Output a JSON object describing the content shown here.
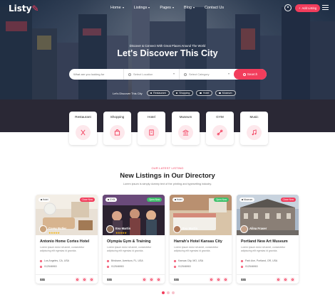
{
  "brand": {
    "name": "Listy",
    "accent": "#f23d5c"
  },
  "nav": {
    "items": [
      {
        "label": "Home",
        "has_caret": true
      },
      {
        "label": "Listings",
        "has_caret": true
      },
      {
        "label": "Pages",
        "has_caret": true
      },
      {
        "label": "Blog",
        "has_caret": true
      },
      {
        "label": "Contact Us",
        "has_caret": false
      }
    ],
    "add_listing_label": "Add Listing",
    "user_icon": "user-icon",
    "menu_icon": "hamburger-icon"
  },
  "hero": {
    "subtitle": "Discover & Connect With Great Places Around The World",
    "title": "Let's Discover This City",
    "search": {
      "keyword_placeholder": "What are you looking for",
      "location_placeholder": "Select Location",
      "category_placeholder": "Select Category",
      "button_label": "Search"
    },
    "quick_label": "Let's Discover This City",
    "quick_chips": [
      "Restaurant",
      "Shopping",
      "Hotel",
      "Museum"
    ]
  },
  "categories": [
    {
      "name": "Restaurant",
      "icon": "fork-knife-icon"
    },
    {
      "name": "Shopping",
      "icon": "shopping-bag-icon"
    },
    {
      "name": "Hotel",
      "icon": "hotel-icon"
    },
    {
      "name": "Museum",
      "icon": "museum-icon"
    },
    {
      "name": "GYM",
      "icon": "gym-icon"
    },
    {
      "name": "Music",
      "icon": "music-icon"
    }
  ],
  "listings_section": {
    "kicker": "OUR LATEST LISTING",
    "title": "New Listings in Our Directory",
    "description": "Lorem ipsum is simply dummy text of the printing and typesetting industry."
  },
  "listings": [
    {
      "tag": "Hotel",
      "status": "Close Now",
      "status_color": "#f23d5c",
      "author": "Corey Butler",
      "rating": 5,
      "name": "Antonio Home Cortes Hotel",
      "desc": "Lorem ipsum dolor sit amet, consectetur adipiscing elit egestas id gravida.",
      "location": "Los Angeles, CA, USA",
      "phone": "012546963",
      "price": "$$$"
    },
    {
      "tag": "GYM",
      "status": "Open Now",
      "status_color": "#3ec16b",
      "author": "Eva Martin",
      "rating": 5,
      "name": "Olympia Gym & Training",
      "desc": "Lorem ipsum dolor sit amet, consectetur adipiscing elit egestas id gravida.",
      "location": "Brisbane, Aventura, FL, USA",
      "phone": "012546963",
      "price": "$$$"
    },
    {
      "tag": "Hotel",
      "status": "Open Now",
      "status_color": "#3ec16b",
      "author": "Eva Martin",
      "rating": 0,
      "name": "Harrah's Hotel Kansas City",
      "desc": "Lorem ipsum dolor sit amet, consectetur adipiscing elit egestas id gravida.",
      "location": "Kansas City, MO, USA",
      "phone": "012546963",
      "price": "$$$"
    },
    {
      "tag": "Museum",
      "status": "Close Now",
      "status_color": "#f23d5c",
      "author": "Alina Fraser",
      "rating": 0,
      "name": "Portland New Art Museum",
      "desc": "Lorem ipsum dolor sit amet, consectetur adipiscing elit egestas id gravida.",
      "location": "Park Ave, Portland, OR, USA",
      "phone": "012546963",
      "price": "$$$"
    }
  ],
  "pagination": {
    "count": 3,
    "active": 1
  }
}
